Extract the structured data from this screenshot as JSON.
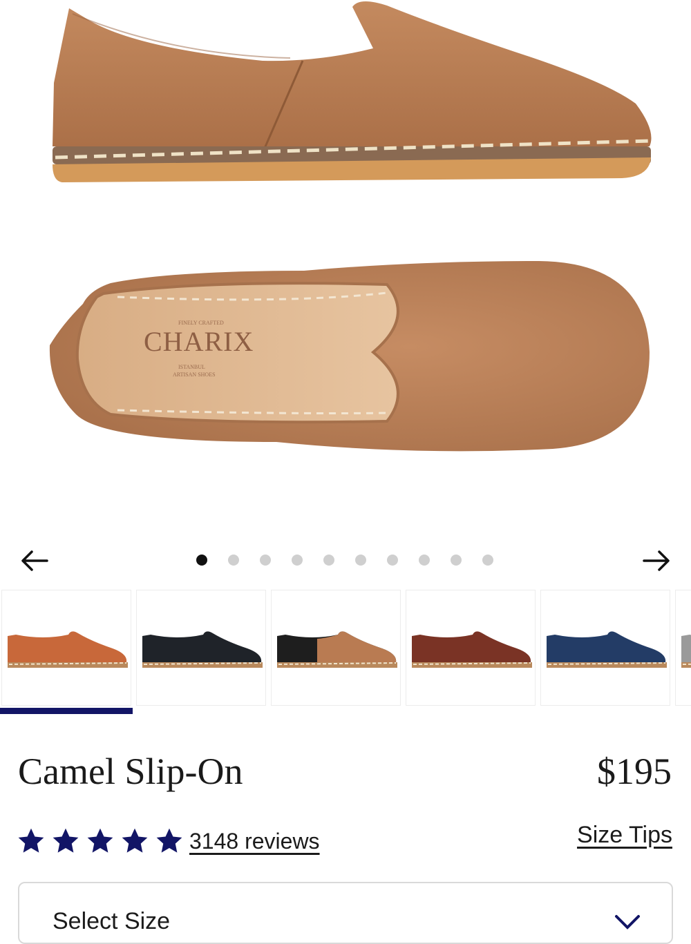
{
  "gallery": {
    "prev_icon": "arrow-left-icon",
    "next_icon": "arrow-right-icon",
    "dot_count": 10,
    "active_index": 1,
    "thumbnails": [
      {
        "color": "#c8683a",
        "name": "tan-shoe"
      },
      {
        "color": "#1f2329",
        "name": "black-shoe"
      },
      {
        "color": "#1e1e1e",
        "name": "black-camel-shoe"
      },
      {
        "color": "#7a3325",
        "name": "burgundy-shoe"
      },
      {
        "color": "#233c66",
        "name": "navy-shoe"
      },
      {
        "color": "#9a9a9a",
        "name": "grey-shoe"
      }
    ]
  },
  "product": {
    "title": "Camel Slip-On",
    "price": "$195",
    "rating_stars": 5,
    "reviews_text": "3148 reviews",
    "size_tips": "Size Tips"
  },
  "size_select": {
    "label": "Select Size",
    "icon": "chevron-down-icon"
  },
  "colors": {
    "accent": "#121566",
    "star": "#121566",
    "camel": "#b97b52"
  }
}
